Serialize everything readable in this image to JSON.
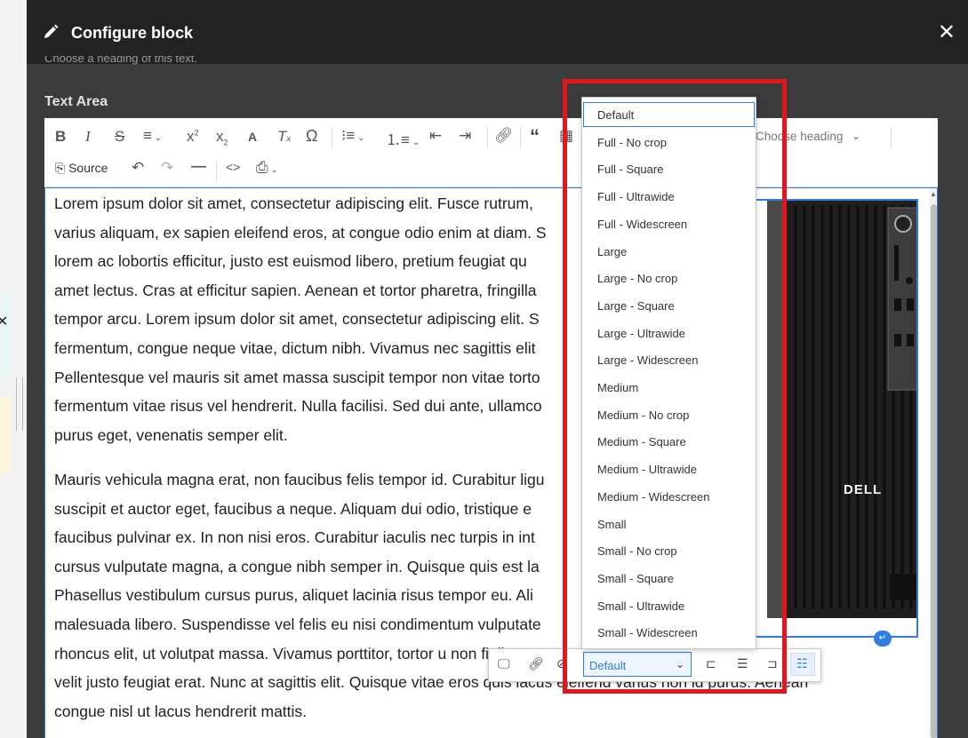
{
  "dialog": {
    "title": "Configure block",
    "close_label": "×",
    "partial_text": "Choose a heading of this text.",
    "field_label": "Text Area"
  },
  "toolbar": {
    "source_label": "Source",
    "heading_placeholder": "Choose heading"
  },
  "content": {
    "paragraph1": [
      "Lorem ipsum dolor sit amet, consectetur adipiscing elit. Fusce rutrum,",
      "varius aliquam, ex sapien eleifend eros, at congue odio enim at diam. S",
      "lorem ac lobortis efficitur, justo est euismod libero, pretium feugiat qu",
      "amet lectus. Cras at efficitur sapien. Aenean et tortor pharetra, fringilla",
      "tempor arcu. Lorem ipsum dolor sit amet, consectetur adipiscing elit. S",
      "fermentum, congue neque vitae, dictum nibh. Vivamus nec sagittis elit",
      "Pellentesque vel mauris sit amet massa suscipit tempor non vitae torto",
      "fermentum vitae risus vel hendrerit. Nulla facilisi. Sed dui ante, ullamco",
      "purus eget, venenatis semper elit."
    ],
    "paragraph2": [
      "Mauris vehicula magna erat, non faucibus felis tempor id. Curabitur ligu",
      "suscipit et auctor eget, faucibus a neque. Aliquam dui odio, tristique e",
      "faucibus pulvinar ex. In non nisi eros. Curabitur iaculis nec turpis in int",
      "cursus vulputate magna, a congue nibh semper in. Quisque quis est la",
      "Phasellus vestibulum cursus purus, aliquet lacinia risus tempor eu. Ali",
      "malesuada libero. Suspendisse vel felis eu nisi condimentum vulputate",
      "rhoncus elit, ut volutpat massa. Vivamus porttitor, tortor u                                                      non finibus",
      "velit justo feugiat erat. Nunc at sagittis elit. Quisque vitae eros quis lacus eleifend varius non id purus. Aenean",
      "congue nisl ut lacus hendrerit mattis."
    ],
    "image_brand": "DELL"
  },
  "image_toolbar": {
    "style_value": "Default"
  },
  "style_dropdown": {
    "options": [
      "Default",
      "Full - No crop",
      "Full - Square",
      "Full - Ultrawide",
      "Full - Widescreen",
      "Large",
      "Large - No crop",
      "Large - Square",
      "Large - Ultrawide",
      "Large - Widescreen",
      "Medium",
      "Medium - No crop",
      "Medium - Square",
      "Medium - Ultrawide",
      "Medium - Widescreen",
      "Small",
      "Small - No crop",
      "Small - Square",
      "Small - Ultrawide",
      "Small - Widescreen"
    ],
    "selected": "Default"
  },
  "colors": {
    "title_bar": "#232323",
    "dialog_bg": "#3b3b3b",
    "accent": "#2f7de1",
    "highlight_border": "#e2171d"
  }
}
